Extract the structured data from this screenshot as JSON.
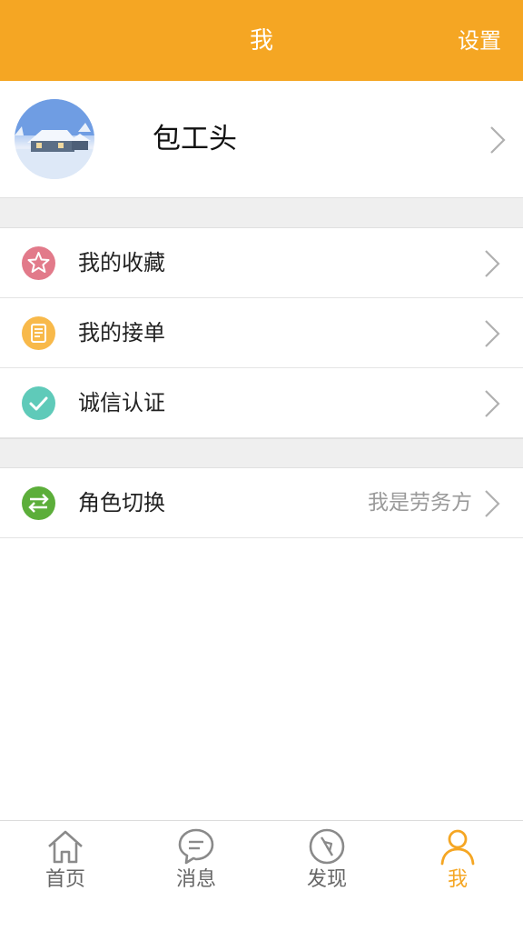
{
  "header": {
    "title": "我",
    "settings_label": "设置"
  },
  "profile": {
    "name": "包工头"
  },
  "menu": [
    {
      "label": "我的收藏",
      "icon": "star-icon",
      "color": "#e27a8a"
    },
    {
      "label": "我的接单",
      "icon": "order-icon",
      "color": "#f8b94a"
    },
    {
      "label": "诚信认证",
      "icon": "check-icon",
      "color": "#5fcab9"
    }
  ],
  "role": {
    "label": "角色切换",
    "value": "我是劳务方",
    "icon": "switch-icon",
    "color": "#5cae3a"
  },
  "tabs": [
    {
      "label": "首页",
      "icon": "home-icon"
    },
    {
      "label": "消息",
      "icon": "message-icon"
    },
    {
      "label": "发现",
      "icon": "compass-icon"
    },
    {
      "label": "我",
      "icon": "user-icon",
      "active": true
    }
  ],
  "colors": {
    "accent": "#f5a623",
    "background": "#efefef"
  }
}
